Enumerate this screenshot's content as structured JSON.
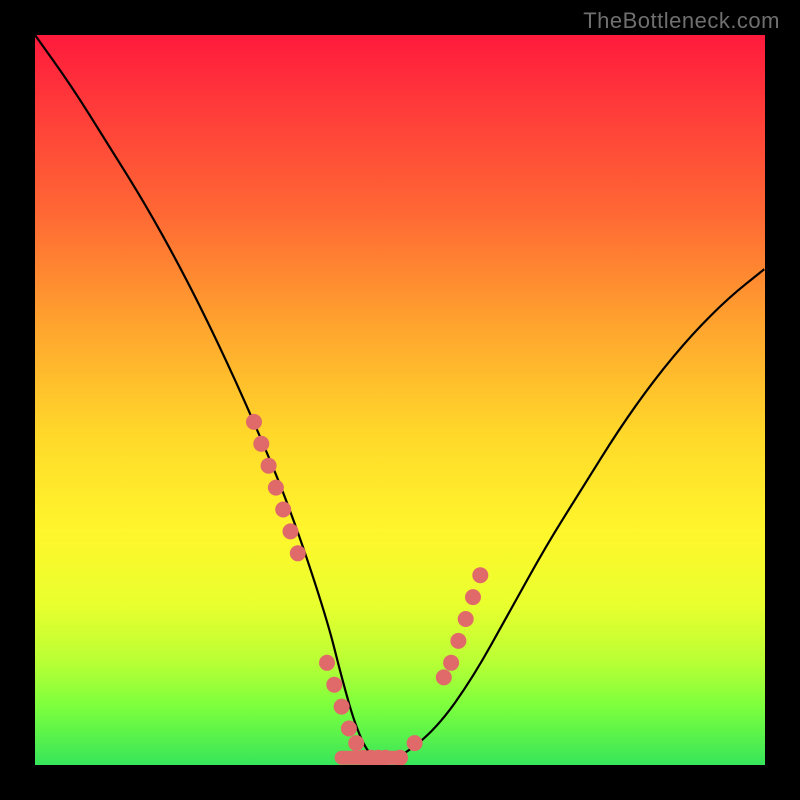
{
  "watermark": "TheBottleneck.com",
  "chart_data": {
    "type": "line",
    "title": "",
    "xlabel": "",
    "ylabel": "",
    "xlim": [
      0,
      100
    ],
    "ylim": [
      0,
      100
    ],
    "series": [
      {
        "name": "bottleneck-curve",
        "x": [
          0,
          5,
          10,
          15,
          20,
          25,
          30,
          35,
          40,
          42,
          44,
          46,
          48,
          50,
          55,
          60,
          65,
          70,
          75,
          80,
          85,
          90,
          95,
          100
        ],
        "y": [
          100,
          93,
          85,
          77,
          68,
          58,
          47,
          35,
          20,
          12,
          5,
          1,
          1,
          1,
          5,
          12,
          21,
          30,
          38,
          46,
          53,
          59,
          64,
          68
        ]
      }
    ],
    "markers": {
      "name": "sample-points",
      "color": "#e06a6a",
      "x": [
        30,
        31,
        32,
        33,
        34,
        35,
        36,
        40,
        41,
        42,
        43,
        44,
        45,
        46,
        47,
        48,
        50,
        52,
        56,
        57,
        58,
        59,
        60,
        61
      ],
      "y": [
        47,
        44,
        41,
        38,
        35,
        32,
        29,
        14,
        11,
        8,
        5,
        3,
        1,
        1,
        1,
        1,
        1,
        3,
        12,
        14,
        17,
        20,
        23,
        26
      ]
    },
    "flat_segment": {
      "name": "optimal-range",
      "color": "#e06a6a",
      "x_start": 42,
      "x_end": 50,
      "y": 1
    }
  }
}
